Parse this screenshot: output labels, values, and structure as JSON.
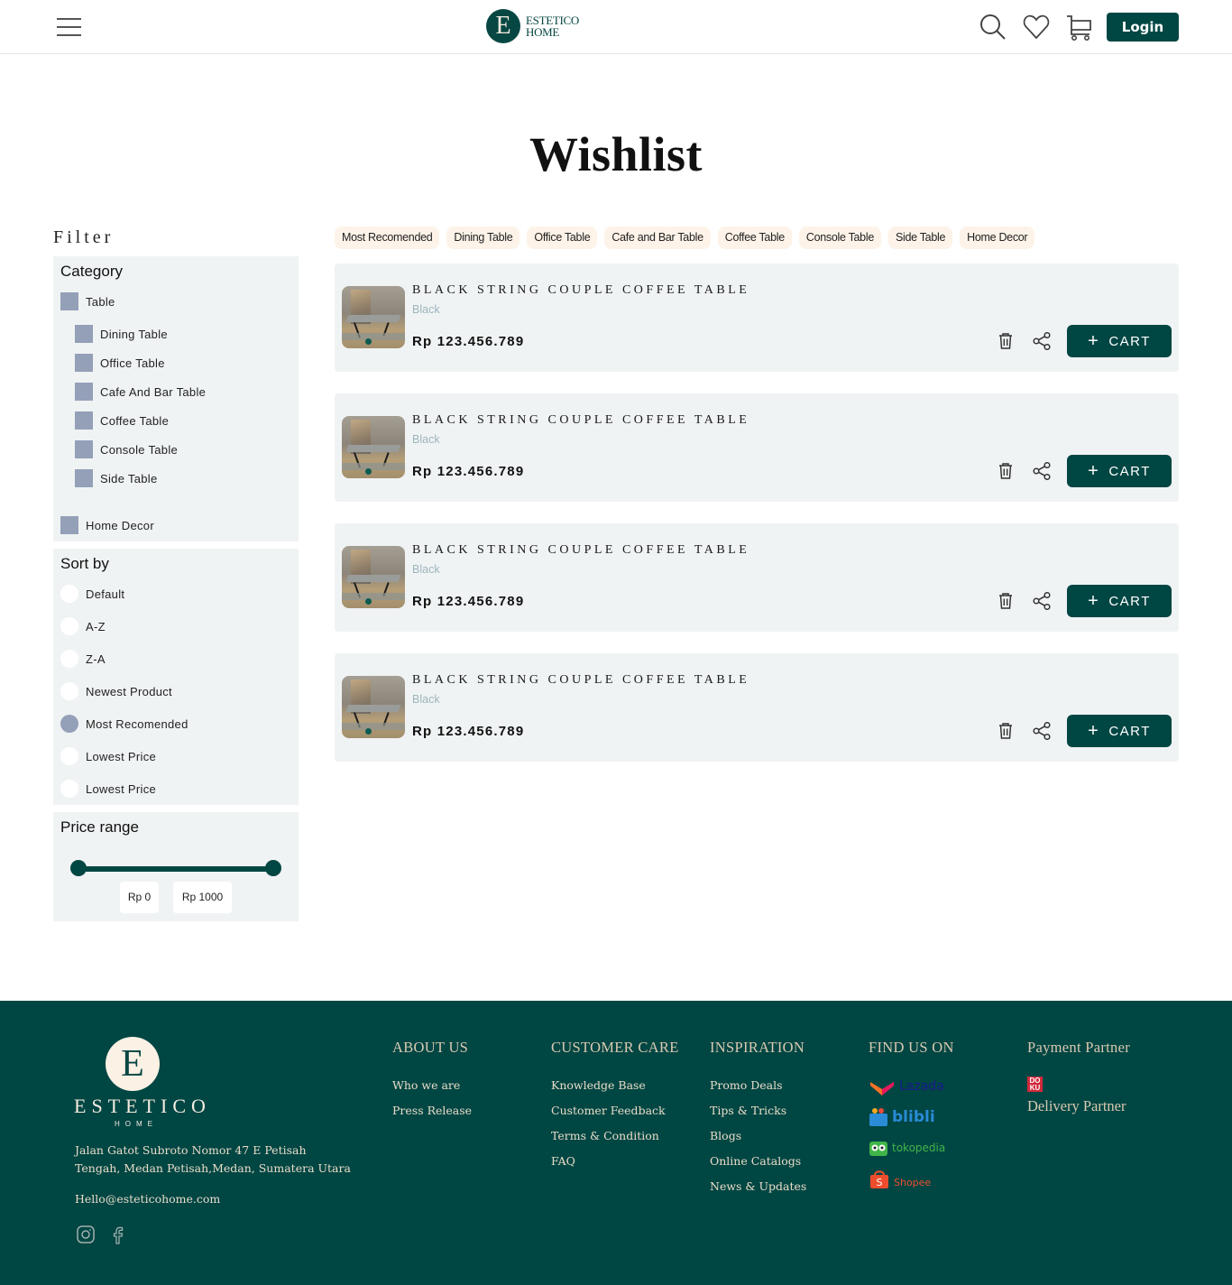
{
  "header": {
    "logo_letter": "E",
    "logo_line1": "ESTETICO",
    "logo_line2": "HOME",
    "login_label": "Login",
    "icons": [
      "menu-icon",
      "search-icon",
      "heart-icon",
      "cart-icon"
    ]
  },
  "page": {
    "title": "Wishlist"
  },
  "filter": {
    "label": "Filter",
    "category": {
      "title": "Category",
      "items": [
        {
          "label": "Table",
          "level": 0
        },
        {
          "label": "Dining Table",
          "level": 1
        },
        {
          "label": "Office Table",
          "level": 1
        },
        {
          "label": "Cafe And Bar Table",
          "level": 1
        },
        {
          "label": "Coffee Table",
          "level": 1
        },
        {
          "label": "Console Table",
          "level": 1
        },
        {
          "label": "Side Table",
          "level": 1
        },
        {
          "label": "Home Decor",
          "level": 0
        }
      ]
    },
    "sort": {
      "title": "Sort by",
      "selected": "Most Recomended",
      "options": [
        "Default",
        "A-Z",
        "Z-A",
        "Newest Product",
        "Most Recomended",
        "Lowest Price",
        "Lowest Price"
      ]
    },
    "price_range": {
      "title": "Price range",
      "min_label": "Rp 0",
      "max_label": "Rp 1000",
      "min": 0,
      "max": 1000
    }
  },
  "chips": [
    "Most Recomended",
    "Dining Table",
    "Office Table",
    "Cafe and Bar Table",
    "Coffee Table",
    "Console Table",
    "Side Table",
    "Home Decor"
  ],
  "wishlist": [
    {
      "name": "BLACK STRING COUPLE COFFEE TABLE",
      "variant": "Black",
      "price": "Rp 123.456.789",
      "cart_label": "CART"
    },
    {
      "name": "BLACK STRING COUPLE COFFEE TABLE",
      "variant": "Black",
      "price": "Rp 123.456.789",
      "cart_label": "CART"
    },
    {
      "name": "BLACK STRING COUPLE COFFEE TABLE",
      "variant": "Black",
      "price": "Rp 123.456.789",
      "cart_label": "CART"
    },
    {
      "name": "BLACK STRING COUPLE COFFEE TABLE",
      "variant": "Black",
      "price": "Rp 123.456.789",
      "cart_label": "CART"
    }
  ],
  "footer": {
    "logo_letter": "E",
    "brand": "ESTETICO",
    "brand_sub": "HOME",
    "address": "Jalan Gatot Subroto Nomor 47 E Petisah Tengah, Medan Petisah,Medan, Sumatera Utara",
    "email": "Hello@esteticohome.com",
    "about": {
      "title": "ABOUT US",
      "links": [
        "Who we are",
        "Press Release"
      ]
    },
    "care": {
      "title": "CUSTOMER CARE",
      "links": [
        "Knowledge Base",
        "Customer Feedback",
        "Terms & Condition",
        "FAQ"
      ]
    },
    "inspiration": {
      "title": "INSPIRATION",
      "links": [
        "Promo Deals",
        "Tips & Tricks",
        "Blogs",
        "Online Catalogs",
        "News & Updates"
      ]
    },
    "find_us": {
      "title": "FIND US ON",
      "shops": [
        {
          "name": "Lazada",
          "color": "#1a1a8c"
        },
        {
          "name": "blibli",
          "color": "#2a8bd6"
        },
        {
          "name": "tokopedia",
          "color": "#42b549"
        },
        {
          "name": "Shopee",
          "color": "#ee4d2d"
        }
      ]
    },
    "payment": {
      "title": "Payment Partner",
      "logo_text": "DOKU"
    },
    "delivery": {
      "title": "Delivery Partner"
    }
  },
  "colors": {
    "brand": "#004643",
    "panel": "#f0f3f4",
    "chip": "#fdf3e8",
    "checkbox": "#94a0b8"
  }
}
